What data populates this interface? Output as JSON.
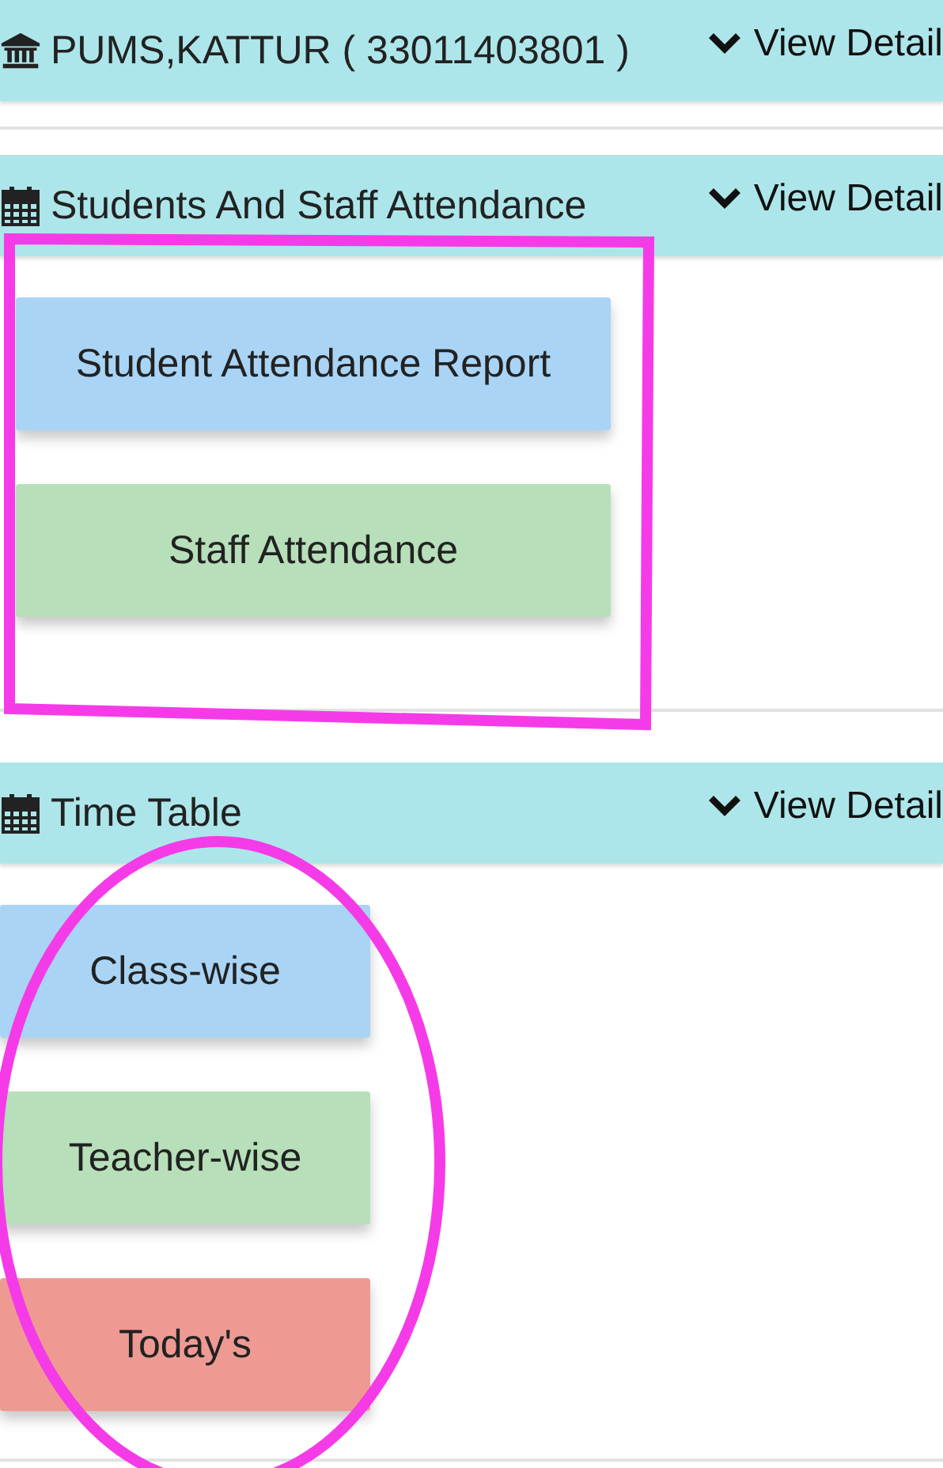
{
  "panels": [
    {
      "kind": "school",
      "title": "PUMS,KATTUR ( 33011403801 )",
      "toggle": "View Detail"
    },
    {
      "kind": "attendance",
      "title": "Students And Staff Attendance",
      "toggle": "View Detail",
      "buttons": [
        {
          "label": "Student Attendance Report",
          "color": "#a9d4f5"
        },
        {
          "label": "Staff Attendance",
          "color": "#b7dfb9"
        }
      ]
    },
    {
      "kind": "timetable",
      "title": "Time Table",
      "toggle": "View Detail",
      "buttons": [
        {
          "label": "Class-wise",
          "color": "#a9d4f5"
        },
        {
          "label": "Teacher-wise",
          "color": "#b7dfb9"
        },
        {
          "label": "Today's",
          "color": "#ee9a93"
        }
      ]
    }
  ]
}
